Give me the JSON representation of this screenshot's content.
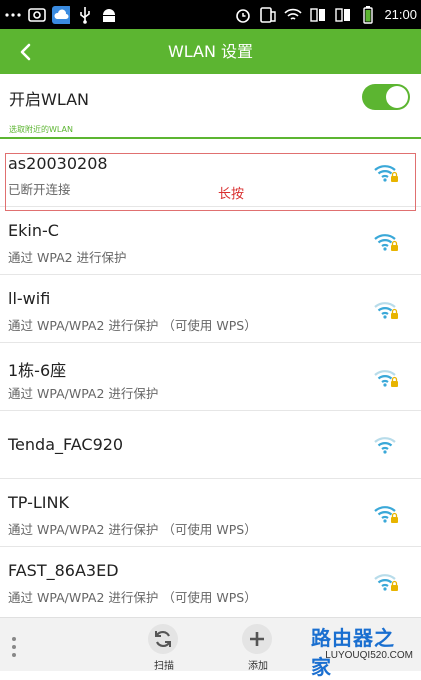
{
  "status_bar": {
    "time": "21:00",
    "left_icons": [
      "more-dots-icon",
      "photo-icon",
      "cloud-icon",
      "usb-icon",
      "android-icon"
    ],
    "right_icons": [
      "alarm-icon",
      "rotate-icon",
      "wifi-signal-icon",
      "sim1-signal-icon",
      "sim2-signal-icon",
      "battery-icon"
    ]
  },
  "header": {
    "title": "WLAN 设置",
    "back_icon": "chevron-left-icon"
  },
  "wlan_toggle": {
    "label": "开启WLAN",
    "enabled": true
  },
  "section_header": "选取附近的WLAN",
  "annotation": {
    "label": "长按"
  },
  "networks": [
    {
      "name": "as20030208",
      "status": "已断开连接",
      "secured": true,
      "highlighted": true
    },
    {
      "name": "Ekin-C",
      "status": "通过 WPA2 进行保护",
      "secured": true
    },
    {
      "name": "ll-wifi",
      "status": "通过 WPA/WPA2 进行保护 （可使用 WPS）",
      "secured": true
    },
    {
      "name": "1栋-6座",
      "status": "通过 WPA/WPA2 进行保护",
      "secured": true
    },
    {
      "name": "Tenda_FAC920",
      "status": "",
      "secured": false
    },
    {
      "name": "TP-LINK",
      "status": "通过 WPA/WPA2 进行保护 （可使用 WPS）",
      "secured": true
    },
    {
      "name": "FAST_86A3ED",
      "status": "通过 WPA/WPA2 进行保护 （可使用 WPS）",
      "secured": true
    }
  ],
  "bottom_bar": {
    "scan_label": "扫描",
    "add_label": "添加",
    "watermark_main": "路由器之家",
    "watermark_sub": "LUYOUQI520.COM"
  },
  "colors": {
    "accent": "#5cb531",
    "wifi_blue": "#3aa8d8",
    "lock_yellow": "#e8b400",
    "annotation_red": "#d93030"
  }
}
